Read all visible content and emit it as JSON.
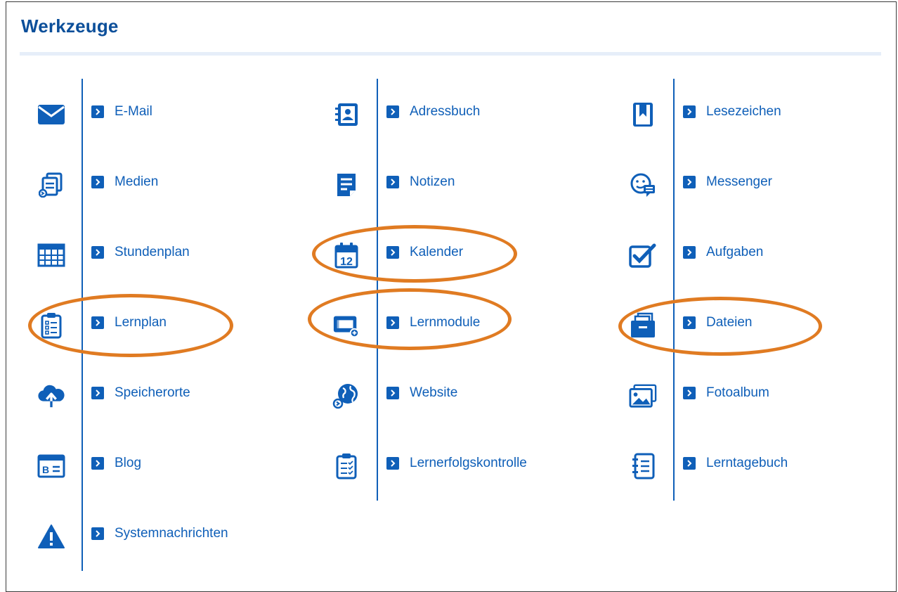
{
  "panel": {
    "title": "Werkzeuge",
    "accent_color": "#0f5fb8",
    "highlight_color": "#e07b22"
  },
  "tools": [
    {
      "label": "E-Mail",
      "icon": "envelope-icon"
    },
    {
      "label": "Adressbuch",
      "icon": "address-book-icon"
    },
    {
      "label": "Lesezeichen",
      "icon": "bookmark-icon"
    },
    {
      "label": "Medien",
      "icon": "media-icon"
    },
    {
      "label": "Notizen",
      "icon": "notes-icon"
    },
    {
      "label": "Messenger",
      "icon": "messenger-icon"
    },
    {
      "label": "Stundenplan",
      "icon": "timetable-grid-icon"
    },
    {
      "label": "Kalender",
      "icon": "calendar-icon",
      "calendar_day": "12"
    },
    {
      "label": "Aufgaben",
      "icon": "checkbox-icon"
    },
    {
      "label": "Lernplan",
      "icon": "clipboard-list-icon"
    },
    {
      "label": "Lernmodule",
      "icon": "learning-module-icon"
    },
    {
      "label": "Dateien",
      "icon": "folder-files-icon"
    },
    {
      "label": "Speicherorte",
      "icon": "cloud-upload-icon"
    },
    {
      "label": "Website",
      "icon": "globe-icon"
    },
    {
      "label": "Fotoalbum",
      "icon": "photo-album-icon"
    },
    {
      "label": "Blog",
      "icon": "blog-icon",
      "icon_text": "B"
    },
    {
      "label": "Lernerfolgskontrolle",
      "icon": "clipboard-check-icon"
    },
    {
      "label": "Lerntagebuch",
      "icon": "journal-icon"
    },
    {
      "label": "Systemnachrichten",
      "icon": "warning-icon"
    }
  ],
  "highlighted_tools": [
    "Kalender",
    "Lernplan",
    "Lernmodule",
    "Dateien"
  ]
}
